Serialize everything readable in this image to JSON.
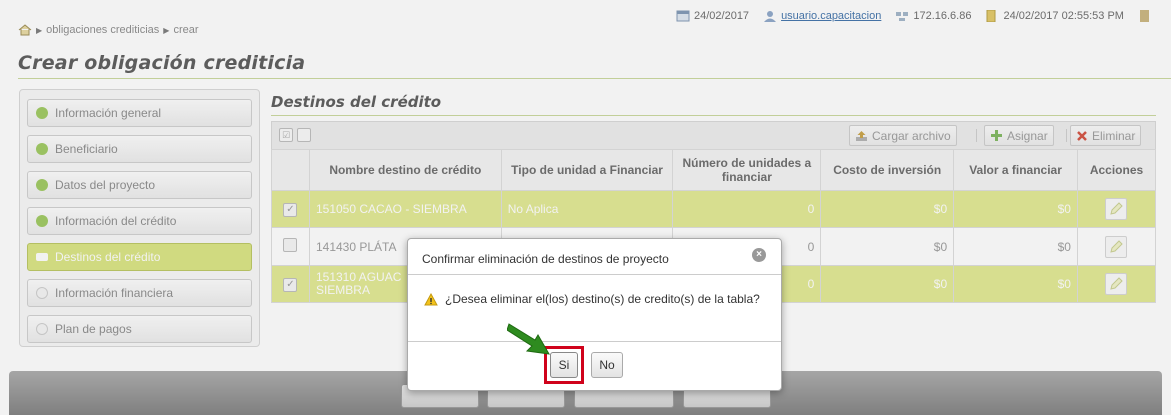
{
  "breadcrumb": {
    "items": [
      "obligaciones crediticias",
      "crear"
    ]
  },
  "status": {
    "date": "24/02/2017",
    "user": "usuario.capacitacion",
    "ip": "172.16.6.86",
    "datetime": "24/02/2017 02:55:53 PM"
  },
  "page_title": "Crear obligación crediticia",
  "sidebar": {
    "items": [
      {
        "label": "Información general",
        "state": "done"
      },
      {
        "label": "Beneficiario",
        "state": "done"
      },
      {
        "label": "Datos del proyecto",
        "state": "done"
      },
      {
        "label": "Información del crédito",
        "state": "done"
      },
      {
        "label": "Destinos del crédito",
        "state": "current"
      },
      {
        "label": "Información financiera",
        "state": "pending"
      },
      {
        "label": "Plan de pagos",
        "state": "pending"
      }
    ]
  },
  "section_title": "Destinos del crédito",
  "toolbar": {
    "cargar_label": "Cargar archivo",
    "asignar_label": "Asignar",
    "eliminar_label": "Eliminar"
  },
  "table": {
    "columns": [
      "Nombre destino de crédito",
      "Tipo de unidad a Financiar",
      "Número de unidades a financiar",
      "Costo de inversión",
      "Valor a financiar",
      "Acciones"
    ],
    "rows": [
      {
        "checked": true,
        "nombre": "151050 CACAO - SIEMBRA",
        "tipo": "No Aplica",
        "unidades": "0",
        "costo": "$0",
        "valor": "$0"
      },
      {
        "checked": false,
        "nombre": "141430 PLÁTA",
        "tipo": "",
        "unidades": "0",
        "costo": "$0",
        "valor": "$0"
      },
      {
        "checked": true,
        "nombre": "151310 AGUAC",
        "nombre2": "SIEMBRA",
        "tipo": "",
        "unidades": "0",
        "costo": "$0",
        "valor": "$0"
      }
    ]
  },
  "dialog": {
    "title": "Confirmar eliminación de destinos de proyecto",
    "message": "¿Desea eliminar el(los) destino(s) de credito(s) de la tabla?",
    "yes_label": "Si",
    "no_label": "No"
  },
  "colors": {
    "accent": "#d9e47e",
    "selected_row": "#e1e98f",
    "highlight": "#d0021b",
    "arrow": "#2e8b1f"
  }
}
